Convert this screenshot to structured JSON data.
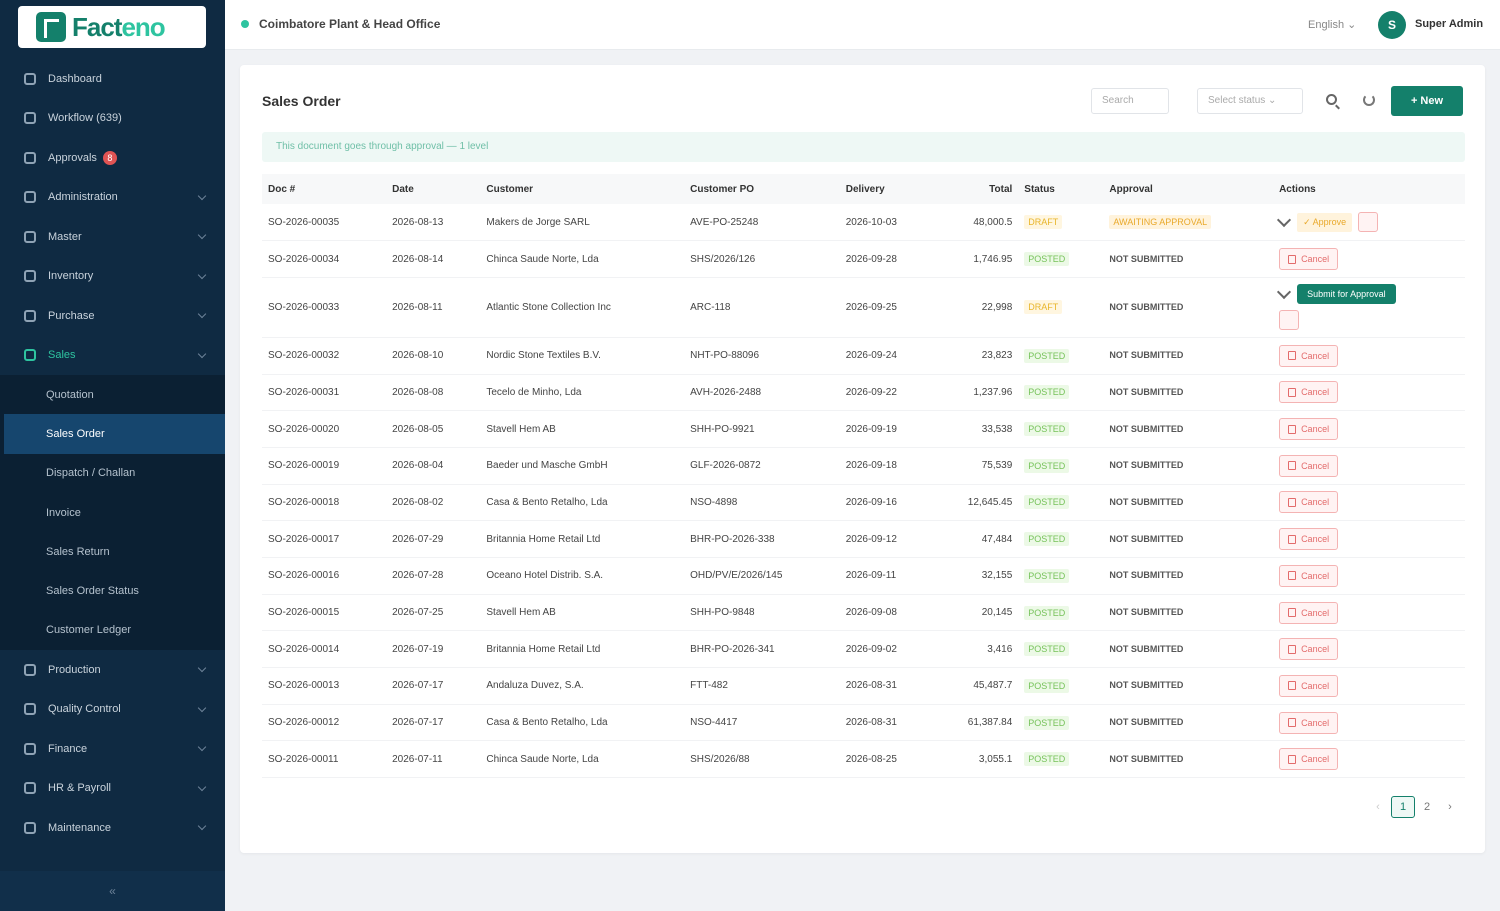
{
  "brand": {
    "logo_text_1": "Fact",
    "logo_text_2": "eno"
  },
  "sidebar": {
    "items": [
      {
        "label": "Dashboard",
        "icon": "dashboard-icon",
        "expandable": false
      },
      {
        "label": "Workflow (639)",
        "icon": "workflow-icon",
        "expandable": false
      },
      {
        "label": "Approvals",
        "icon": "approval-icon",
        "expandable": false,
        "badge": "8"
      },
      {
        "label": "Administration",
        "icon": "admin-icon",
        "expandable": true
      },
      {
        "label": "Master",
        "icon": "master-icon",
        "expandable": true
      },
      {
        "label": "Inventory",
        "icon": "inventory-icon",
        "expandable": true
      },
      {
        "label": "Purchase",
        "icon": "purchase-icon",
        "expandable": true
      },
      {
        "label": "Sales",
        "icon": "sales-icon",
        "expandable": true,
        "open": true
      }
    ],
    "sales_sub": [
      "Quotation",
      "Sales Order",
      "Dispatch / Challan",
      "Invoice",
      "Sales Return",
      "Sales Order Status",
      "Customer Ledger"
    ],
    "active_sub": "Sales Order",
    "items_after": [
      {
        "label": "Production",
        "icon": "production-icon"
      },
      {
        "label": "Quality Control",
        "icon": "quality-icon"
      },
      {
        "label": "Finance",
        "icon": "finance-icon"
      },
      {
        "label": "HR & Payroll",
        "icon": "hr-icon"
      },
      {
        "label": "Maintenance",
        "icon": "maintenance-icon"
      }
    ],
    "collapse_glyph": "«"
  },
  "topbar": {
    "plant": "Coimbatore Plant & Head Office",
    "language": "English ⌄",
    "avatar_initial": "S",
    "user": "Super Admin"
  },
  "page": {
    "title": "Sales Order",
    "search_placeholder": "Search",
    "status_placeholder": "Select status ⌄",
    "new_label": "+ New",
    "alert": "This document goes through approval — 1 level",
    "columns": [
      "Doc #",
      "Date",
      "Customer",
      "Customer PO",
      "Delivery",
      "Total",
      "Status",
      "Approval",
      "Actions"
    ],
    "rows": [
      {
        "doc": "SO-2026-00035",
        "date": "2026-08-13",
        "customer": "Makers de Jorge SARL",
        "po": "AVE-PO-25248",
        "delivery": "2026-10-03",
        "total": "48,000.5",
        "status": "DRAFT",
        "approval": "AWAITING APPROVAL",
        "action": "approve"
      },
      {
        "doc": "SO-2026-00034",
        "date": "2026-08-14",
        "customer": "Chinca Saude Norte, Lda",
        "po": "SHS/2026/126",
        "delivery": "2026-09-28",
        "total": "1,746.95",
        "status": "POSTED",
        "approval": "NOT SUBMITTED",
        "action": "cancel"
      },
      {
        "doc": "SO-2026-00033",
        "date": "2026-08-11",
        "customer": "Atlantic Stone Collection Inc",
        "po": "ARC-118",
        "delivery": "2026-09-25",
        "total": "22,998",
        "status": "DRAFT",
        "approval": "NOT SUBMITTED",
        "action": "submit"
      },
      {
        "doc": "SO-2026-00032",
        "date": "2026-08-10",
        "customer": "Nordic Stone Textiles B.V.",
        "po": "NHT-PO-88096",
        "delivery": "2026-09-24",
        "total": "23,823",
        "status": "POSTED",
        "approval": "NOT SUBMITTED",
        "action": "cancel"
      },
      {
        "doc": "SO-2026-00031",
        "date": "2026-08-08",
        "customer": "Tecelo de Minho, Lda",
        "po": "AVH-2026-2488",
        "delivery": "2026-09-22",
        "total": "1,237.96",
        "status": "POSTED",
        "approval": "NOT SUBMITTED",
        "action": "cancel"
      },
      {
        "doc": "SO-2026-00020",
        "date": "2026-08-05",
        "customer": "Stavell Hem AB",
        "po": "SHH-PO-9921",
        "delivery": "2026-09-19",
        "total": "33,538",
        "status": "POSTED",
        "approval": "NOT SUBMITTED",
        "action": "cancel"
      },
      {
        "doc": "SO-2026-00019",
        "date": "2026-08-04",
        "customer": "Baeder und Masche GmbH",
        "po": "GLF-2026-0872",
        "delivery": "2026-09-18",
        "total": "75,539",
        "status": "POSTED",
        "approval": "NOT SUBMITTED",
        "action": "cancel"
      },
      {
        "doc": "SO-2026-00018",
        "date": "2026-08-02",
        "customer": "Casa & Bento Retalho, Lda",
        "po": "NSO-4898",
        "delivery": "2026-09-16",
        "total": "12,645.45",
        "status": "POSTED",
        "approval": "NOT SUBMITTED",
        "action": "cancel"
      },
      {
        "doc": "SO-2026-00017",
        "date": "2026-07-29",
        "customer": "Britannia Home Retail Ltd",
        "po": "BHR-PO-2026-338",
        "delivery": "2026-09-12",
        "total": "47,484",
        "status": "POSTED",
        "approval": "NOT SUBMITTED",
        "action": "cancel"
      },
      {
        "doc": "SO-2026-00016",
        "date": "2026-07-28",
        "customer": "Oceano Hotel Distrib. S.A.",
        "po": "OHD/PV/E/2026/145",
        "delivery": "2026-09-11",
        "total": "32,155",
        "status": "POSTED",
        "approval": "NOT SUBMITTED",
        "action": "cancel"
      },
      {
        "doc": "SO-2026-00015",
        "date": "2026-07-25",
        "customer": "Stavell Hem AB",
        "po": "SHH-PO-9848",
        "delivery": "2026-09-08",
        "total": "20,145",
        "status": "POSTED",
        "approval": "NOT SUBMITTED",
        "action": "cancel"
      },
      {
        "doc": "SO-2026-00014",
        "date": "2026-07-19",
        "customer": "Britannia Home Retail Ltd",
        "po": "BHR-PO-2026-341",
        "delivery": "2026-09-02",
        "total": "3,416",
        "status": "POSTED",
        "approval": "NOT SUBMITTED",
        "action": "cancel"
      },
      {
        "doc": "SO-2026-00013",
        "date": "2026-07-17",
        "customer": "Andaluza Duvez, S.A.",
        "po": "FTT-482",
        "delivery": "2026-08-31",
        "total": "45,487.7",
        "status": "POSTED",
        "approval": "NOT SUBMITTED",
        "action": "cancel"
      },
      {
        "doc": "SO-2026-00012",
        "date": "2026-07-17",
        "customer": "Casa & Bento Retalho, Lda",
        "po": "NSO-4417",
        "delivery": "2026-08-31",
        "total": "61,387.84",
        "status": "POSTED",
        "approval": "NOT SUBMITTED",
        "action": "cancel"
      },
      {
        "doc": "SO-2026-00011",
        "date": "2026-07-11",
        "customer": "Chinca Saude Norte, Lda",
        "po": "SHS/2026/88",
        "delivery": "2026-08-25",
        "total": "3,055.1",
        "status": "POSTED",
        "approval": "NOT SUBMITTED",
        "action": "cancel"
      }
    ],
    "labels": {
      "cancel": "Cancel",
      "approve": "✓ Approve",
      "submit": "Submit for Approval"
    },
    "pager": {
      "prev": "‹",
      "p1": "1",
      "p2": "2",
      "next": "›"
    }
  },
  "colors": {
    "accent": "#14806b",
    "sidebar_bg": "#0f2a42",
    "posted": "#76c25a",
    "draft": "#e8b52a",
    "danger": "#e36b6b"
  }
}
